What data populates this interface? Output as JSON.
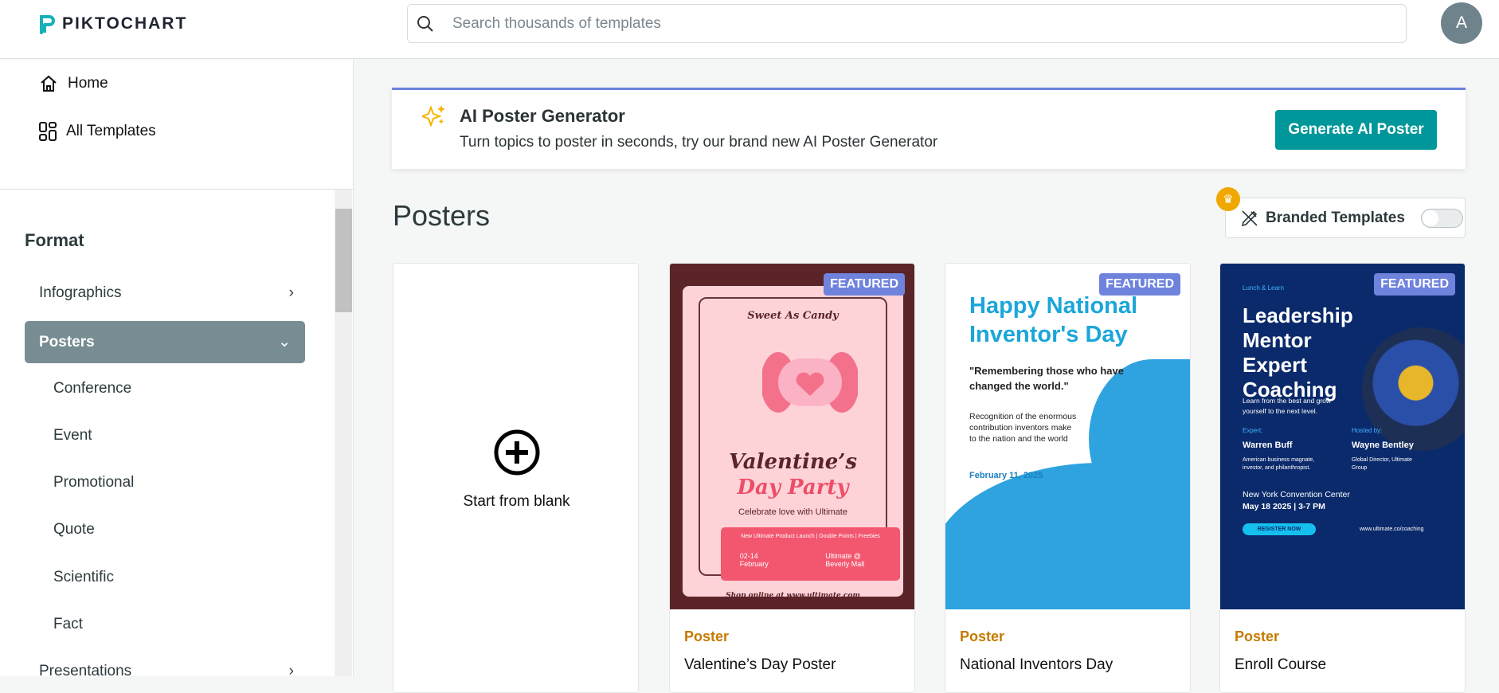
{
  "header": {
    "logo": "PIKTOCHART",
    "search_placeholder": "Search thousands of templates",
    "avatar_initial": "A"
  },
  "sidebar": {
    "home": "Home",
    "all_templates": "All Templates",
    "format_heading": "Format",
    "infographics": "Infographics",
    "posters": "Posters",
    "poster_subs": [
      "Conference",
      "Event",
      "Promotional",
      "Quote",
      "Scientific",
      "Fact"
    ],
    "presentations": "Presentations"
  },
  "banner": {
    "title": "AI Poster Generator",
    "subtitle": "Turn topics to poster in seconds, try our brand new AI Poster Generator",
    "button": "Generate AI Poster",
    "accent": "#6b82db",
    "button_color": "#00979a"
  },
  "main": {
    "title": "Posters",
    "branded_label": "Branded Templates",
    "branded_on": false,
    "blank_label": "Start from blank"
  },
  "cards": [
    {
      "badge": "FEATURED",
      "category": "Poster",
      "name": "Valentine’s Day Poster",
      "poster": {
        "top": "Sweet As Candy",
        "title1": "Valentine’s",
        "title2": "Day Party",
        "tagline": "Celebrate love with Ultimate",
        "promo": "New Ultimate Product Launch | Double Points | Freebies",
        "date": "02-14 February",
        "place": "Ultimate @ Beverly Mall",
        "shop": "Shop online at www.ultimate.com"
      }
    },
    {
      "badge": "FEATURED",
      "category": "Poster",
      "name": "National Inventors Day",
      "poster": {
        "title": "Happy National Inventor's Day",
        "quote": "\"Remembering those who have changed the world.\"",
        "body": "Recognition of the enormous contribution inventors make to the nation and the world",
        "date": "February 11, 2025"
      }
    },
    {
      "badge": "FEATURED",
      "category": "Poster",
      "name": "Enroll Course",
      "poster": {
        "top": "Lunch & Learn",
        "title": "Leadership Mentor Expert Coaching",
        "intro": "Learn from the best and grow yourself to the next level.",
        "expert_label": "Expert:",
        "expert": "Warren Buff",
        "expert_desc": "American business magnate, investor, and philanthropist.",
        "host_label": "Hosted by:",
        "host": "Wayne Bentley",
        "host_desc": "Global Director, Ultimate Group",
        "venue": "New York Convention Center",
        "when": "May 18 2025 | 3-7 PM",
        "cta": "REGISTER NOW",
        "url": "www.ultimate.co/coaching"
      }
    }
  ]
}
